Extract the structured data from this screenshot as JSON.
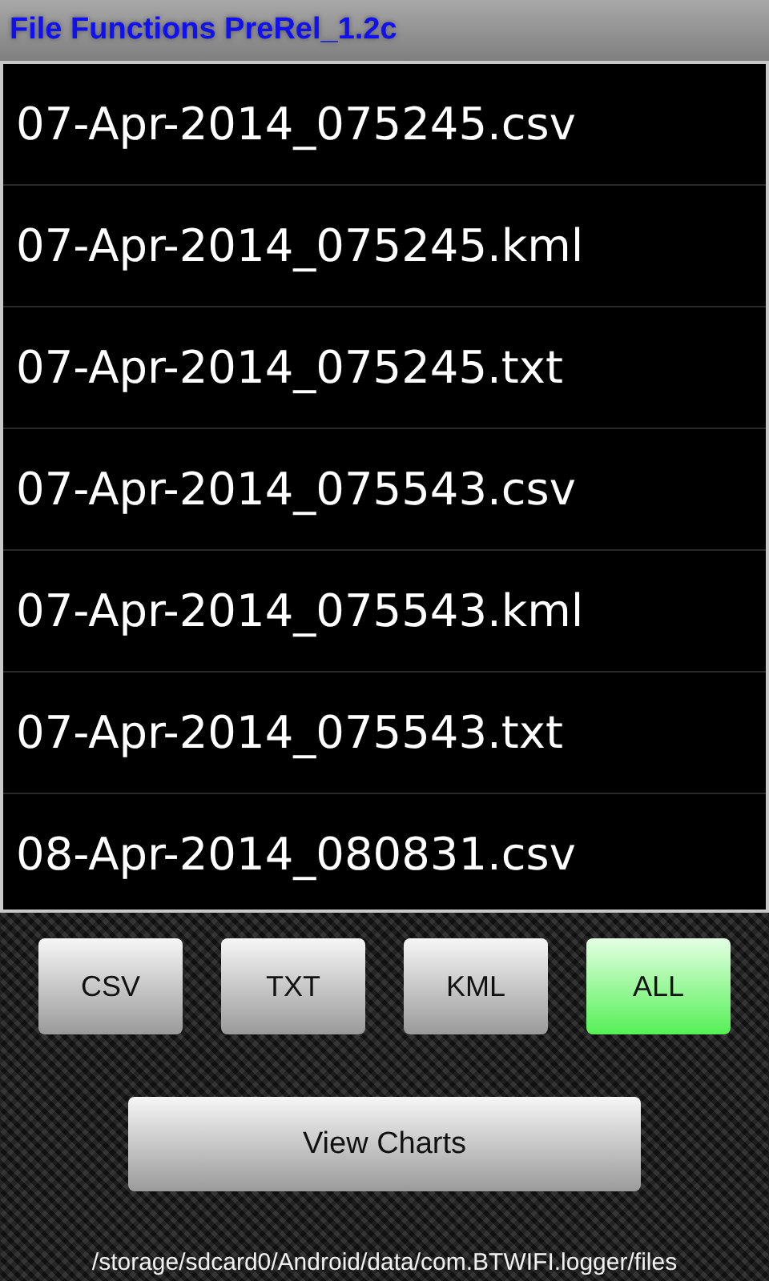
{
  "title": "File Functions PreRel_1.2c",
  "files": [
    {
      "name": "07-Apr-2014_075245.csv"
    },
    {
      "name": "07-Apr-2014_075245.kml"
    },
    {
      "name": "07-Apr-2014_075245.txt"
    },
    {
      "name": "07-Apr-2014_075543.csv"
    },
    {
      "name": "07-Apr-2014_075543.kml"
    },
    {
      "name": "07-Apr-2014_075543.txt"
    },
    {
      "name": "08-Apr-2014_080831.csv"
    }
  ],
  "filters": [
    {
      "label": "CSV",
      "selected": false
    },
    {
      "label": "TXT",
      "selected": false
    },
    {
      "label": "KML",
      "selected": false
    },
    {
      "label": "ALL",
      "selected": true
    }
  ],
  "action": "View Charts",
  "path": "/storage/sdcard0/Android/data/com.BTWIFI.logger/files"
}
